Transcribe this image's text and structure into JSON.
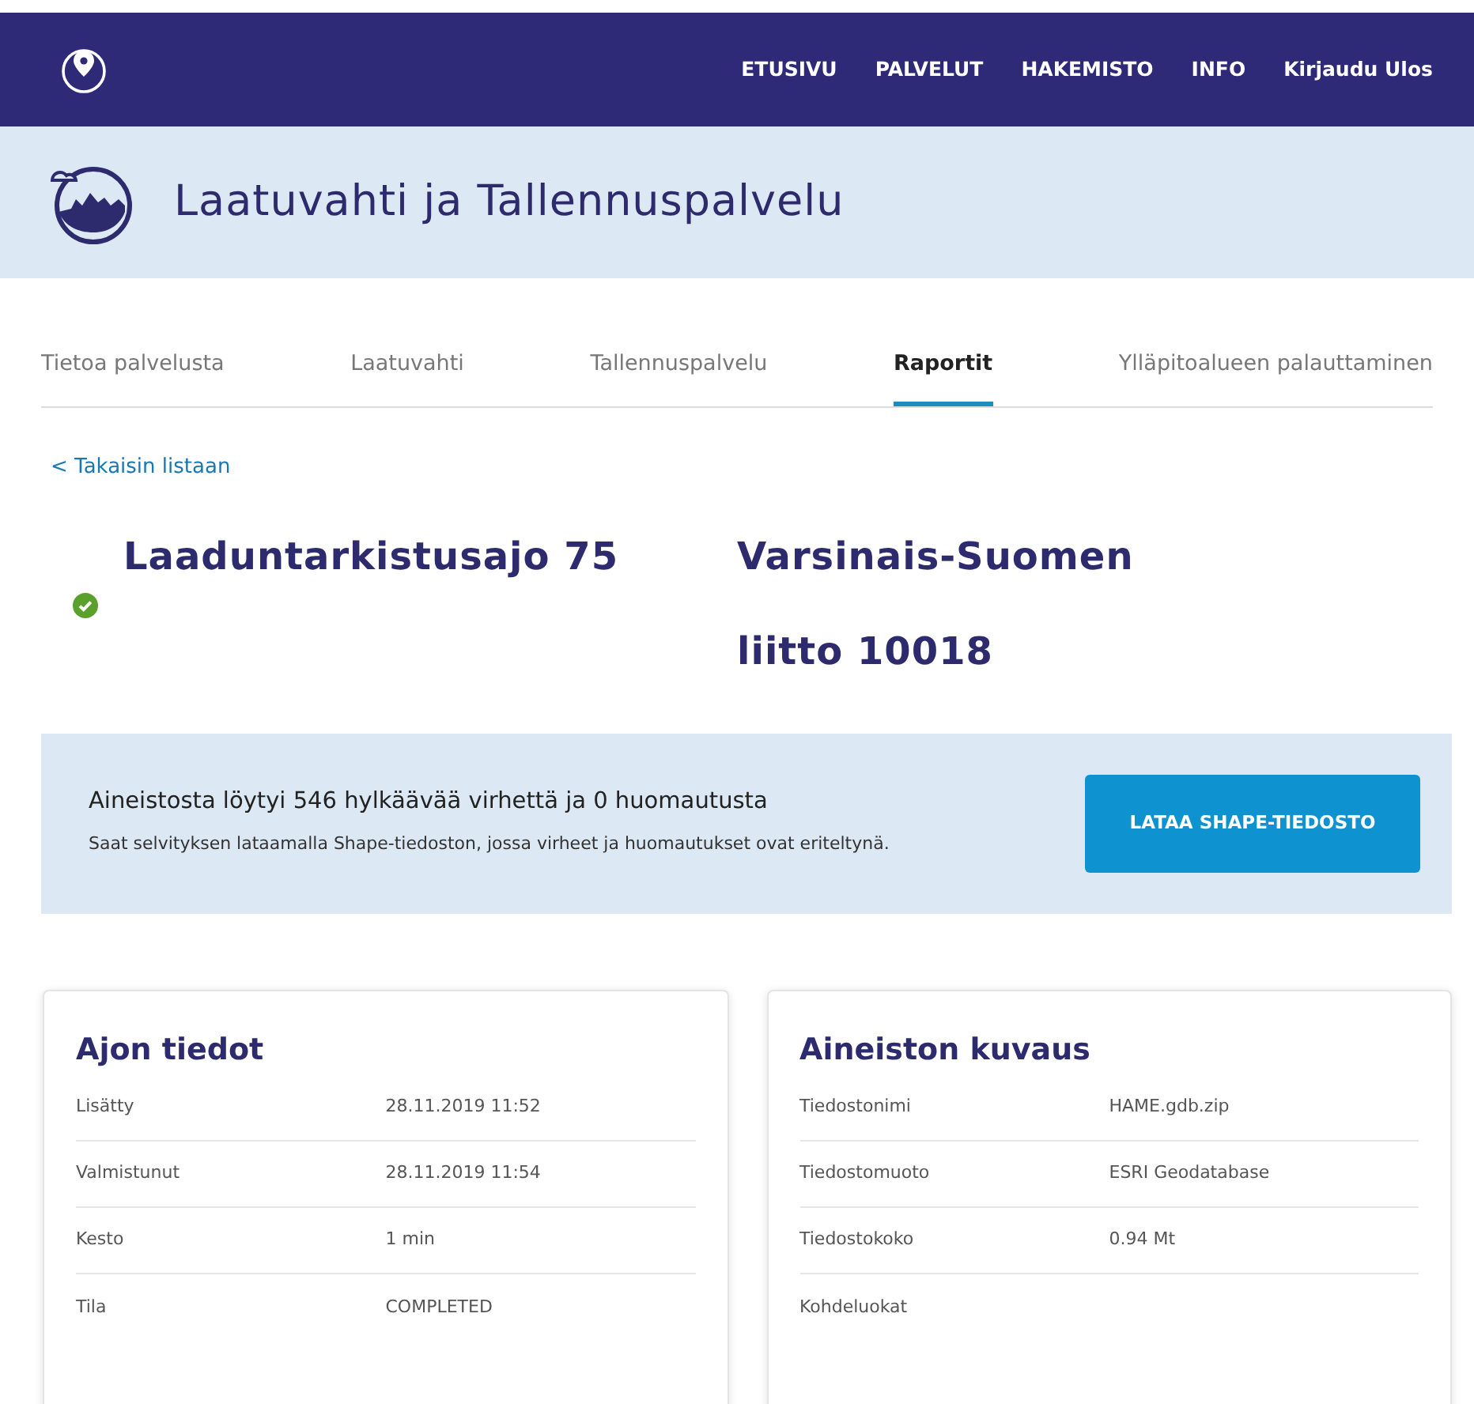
{
  "navbar": {
    "links": [
      "ETUSIVU",
      "PALVELUT",
      "HAKEMISTO",
      "INFO",
      "Kirjaudu Ulos"
    ]
  },
  "banner": {
    "title": "Laatuvahti ja Tallennuspalvelu"
  },
  "tabs": [
    {
      "label": "Tietoa palvelusta",
      "selected": false
    },
    {
      "label": "Laatuvahti",
      "selected": false
    },
    {
      "label": "Tallennuspalvelu",
      "selected": false
    },
    {
      "label": "Raportit",
      "selected": true
    },
    {
      "label": "Ylläpitoalueen palauttaminen",
      "selected": false
    }
  ],
  "back_link": "< Takaisin listaan",
  "report": {
    "success": true,
    "title": "Laaduntarkistusajo 75",
    "organisation": "Varsinais-Suomen liitto  10018"
  },
  "notice": {
    "heading": "Aineistosta löytyi 546 hylkäävää virhettä ja 0 huomautusta",
    "text": "Saat selvityksen lataamalla Shape-tiedoston, jossa virheet ja huomautukset ovat eriteltynä.",
    "button": "LATAA SHAPE-TIEDOSTO"
  },
  "cards": [
    {
      "title": "Ajon tiedot",
      "rows": [
        {
          "label": "Lisätty",
          "value": "28.11.2019 11:52"
        },
        {
          "label": "Valmistunut",
          "value": "28.11.2019 11:54"
        },
        {
          "label": "Kesto",
          "value": "1 min"
        },
        {
          "label": "Tila",
          "value": "COMPLETED"
        }
      ]
    },
    {
      "title": "Aineiston kuvaus",
      "rows": [
        {
          "label": "Tiedostonimi",
          "value": "HAME.gdb.zip"
        },
        {
          "label": "Tiedostomuoto",
          "value": "ESRI Geodatabase"
        },
        {
          "label": "Tiedostokoko",
          "value": "0.94 Mt"
        },
        {
          "label": "Kohdeluokat"
        }
      ]
    }
  ]
}
